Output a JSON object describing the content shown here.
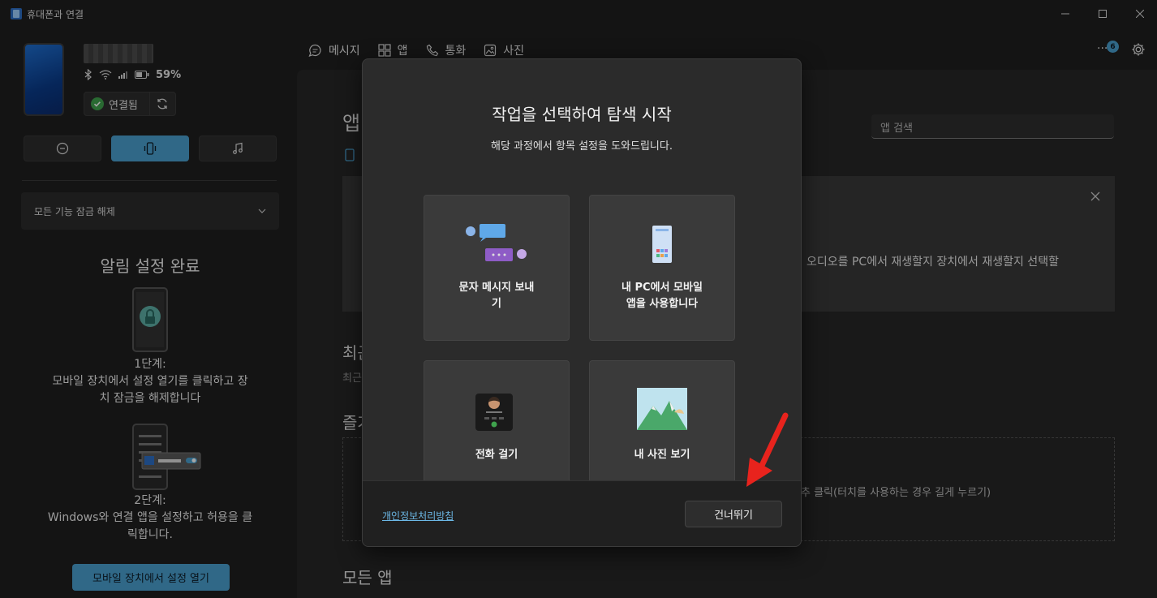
{
  "window": {
    "title": "휴대폰과 연결"
  },
  "device": {
    "battery": "59%",
    "connection_status": "연결됨"
  },
  "sidebar": {
    "unlock_label": "모든 기능 잠금 해제",
    "setup_title": "알림 설정 완료",
    "step1": {
      "label": "1단계:",
      "line1": "모바일 장치에서 설정 열기를 클릭하고 장",
      "line2": "치 잠금을 해제합니다"
    },
    "step2": {
      "label": "2단계:",
      "line1": "Windows와 연결 앱을 설정하고 허용을 클",
      "line2": "릭합니다."
    },
    "open_button": "모바일 장치에서 설정 열기"
  },
  "nav": {
    "messages": "메시지",
    "apps": "앱",
    "calls": "통화",
    "photos": "사진",
    "badge_count": "6"
  },
  "main": {
    "title": "앱",
    "search_placeholder": "앱 검색",
    "banner_text": "오디오를 PC에서 재생할지 장치에서 재생할지 선택할",
    "recent_title": "최근",
    "recent_sub": "최근",
    "favorites_title": "즐겨",
    "favorites_hint": "추 클릭(터치를 사용하는 경우 길게 누르기)",
    "all_apps_title": "모든 앱"
  },
  "dialog": {
    "title": "작업을 선택하여 탐색 시작",
    "subtitle": "해당 과정에서 항목 설정을 도와드립니다.",
    "cards": {
      "send_text": {
        "line1": "문자 메시지 보내",
        "line2": "기"
      },
      "use_apps": {
        "line1": "내 PC에서 모바일",
        "line2": "앱을 사용합니다"
      },
      "make_call": {
        "line1": "전화 걸기"
      },
      "view_photos": {
        "line1": "내 사진 보기"
      }
    },
    "privacy_link": "개인정보처리방침",
    "skip_button": "건너뛰기"
  },
  "colors": {
    "accent": "#4aa0d0",
    "background": "#202020",
    "arrow": "#e8231d",
    "connected_green": "#3fa34d"
  }
}
